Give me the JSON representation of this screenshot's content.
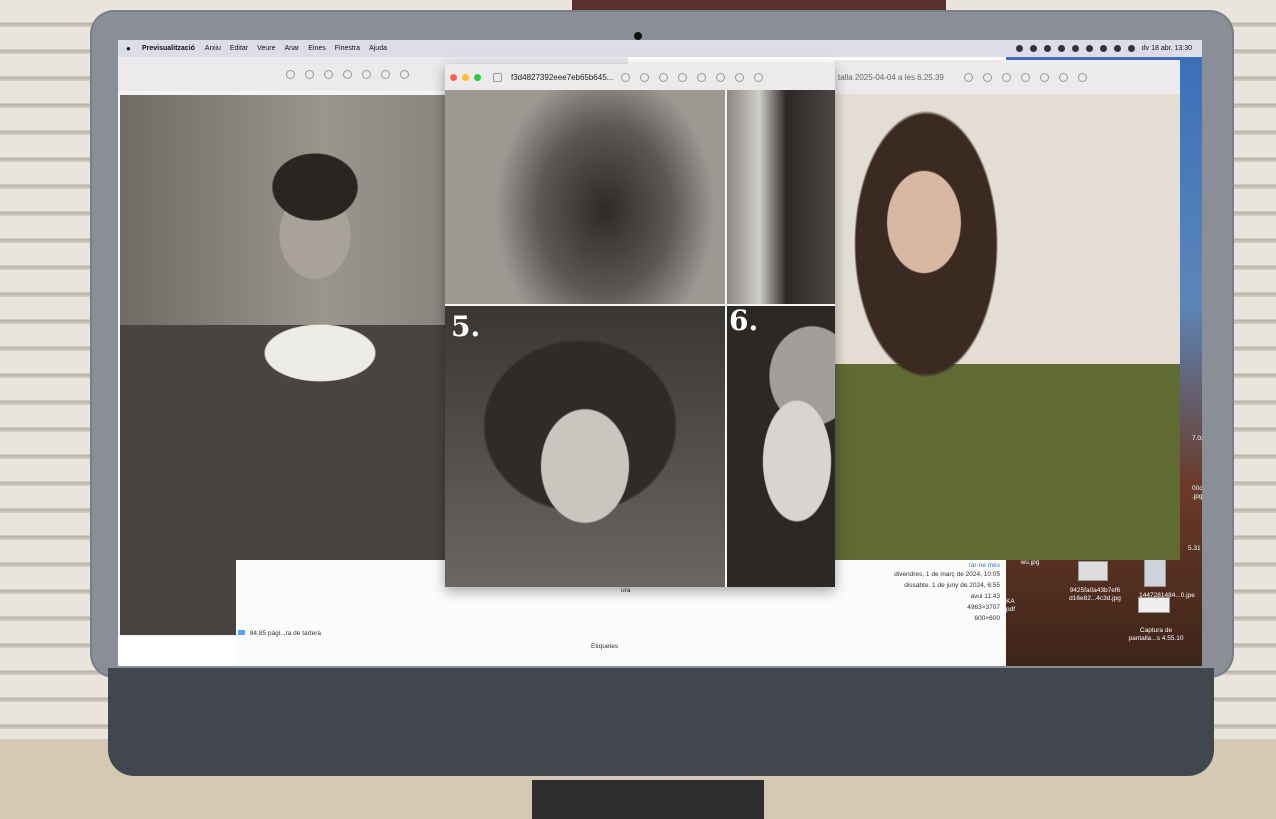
{
  "menubar": {
    "app_name": "Previsualització",
    "items": [
      "Arxiu",
      "Editar",
      "Veure",
      "Anar",
      "Eines",
      "Finestra",
      "Ajuda"
    ],
    "clock": "dv 18 abr. 13:30"
  },
  "front_window": {
    "title": "f3d4827392eee7eb65b645...",
    "labels": [
      "5.",
      "6."
    ]
  },
  "right_window": {
    "title": "talla 2025-04-04 a les 6.25.39"
  },
  "info_panel": {
    "more_link": "rar-ne més",
    "dates": [
      "divendres, 1 de març de 2024, 10:05",
      "dissabte, 1 de juny de 2024, 6:55"
    ],
    "time": "avui 11:43",
    "dim1": "4963×3707",
    "dim2": "600×600",
    "truncated_label": "ura",
    "tags_label": "Etiquetes"
  },
  "sidebar_files": [
    "84,85 pàgi...ra de tartera"
  ],
  "desktop_files": [
    {
      "name": "wu.jpg"
    },
    {
      "name": "9425fa0a43b7ef6 d16e82...4c3d.jpg"
    },
    {
      "name": "1447281484...0.jpe"
    },
    {
      "name": "Captura de pantalla...s 4.55.10"
    }
  ],
  "desktop_edge_labels": [
    "7.02",
    "00d",
    ".jpg",
    "5.31",
    "KA",
    "pdf"
  ]
}
